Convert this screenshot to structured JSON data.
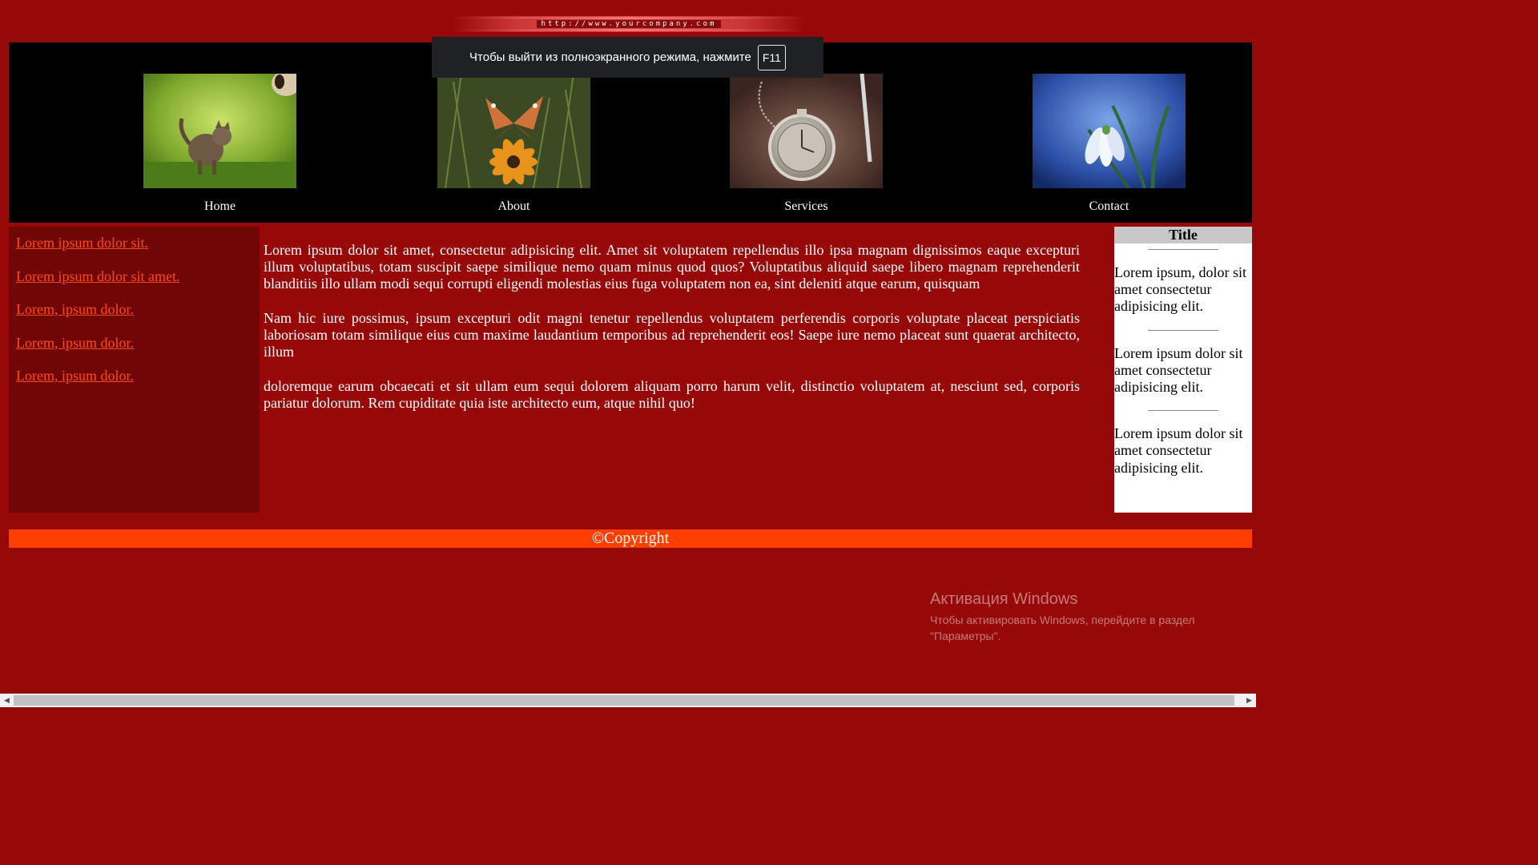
{
  "site_url": "http://www.yourcompany.com",
  "nav": [
    {
      "label": "Home",
      "image": "kitten-photo"
    },
    {
      "label": "About",
      "image": "butterfly-flower-photo"
    },
    {
      "label": "Services",
      "image": "pocket-watch-photo"
    },
    {
      "label": "Contact",
      "image": "snowdrop-flower-photo"
    }
  ],
  "fullscreen_toast": {
    "text": "Чтобы выйти из полноэкранного режима, нажмите",
    "key": "F11"
  },
  "left_links": [
    "Lorem ipsum dolor sit.",
    "Lorem ipsum dolor sit amet.",
    "Lorem, ipsum dolor.",
    "Lorem, ipsum dolor.",
    "Lorem, ipsum dolor."
  ],
  "main_paragraphs": [
    "Lorem ipsum dolor sit amet, consectetur adipisicing elit. Amet sit voluptatem repellendus illo ipsa magnam dignissimos eaque excepturi illum voluptatibus, totam suscipit saepe similique nemo quam minus quod quos? Voluptatibus aliquid saepe libero magnam reprehenderit blanditiis illo ullam modi sequi corrupti eligendi molestias eius fuga voluptatem non ea, sint deleniti atque earum, quisquam",
    "Nam hic iure possimus, ipsum excepturi odit magni tenetur repellendus voluptatem perferendis corporis voluptate placeat perspiciatis laboriosam totam similique eius cum maxime laudantium temporibus ad reprehenderit eos! Saepe iure nemo placeat sunt quaerat architecto, illum",
    "doloremque earum obcaecati et sit ullam eum sequi dolorem aliquam porro harum velit, distinctio voluptatem at, nesciunt sed, corporis pariatur dolorum. Rem cupiditate quia iste architecto eum, atque nihil quo!"
  ],
  "right_sidebar": {
    "title": "Title",
    "items": [
      "Lorem ipsum, dolor sit amet consectetur adipisicing elit.",
      "Lorem ipsum dolor sit amet consectetur adipisicing elit.",
      "Lorem ipsum dolor sit amet consectetur adipisicing elit."
    ]
  },
  "footer": {
    "text": "©Copyright"
  },
  "watermark": {
    "title": "Активация Windows",
    "text": "Чтобы активировать Windows, перейдите в раздел \"Параметры\"."
  },
  "colors": {
    "page_bg": "#970909",
    "left_sidebar_bg": "#710606",
    "link": "#ff4a14",
    "footer_bg": "#ff3f00",
    "header_bg": "#000000"
  }
}
